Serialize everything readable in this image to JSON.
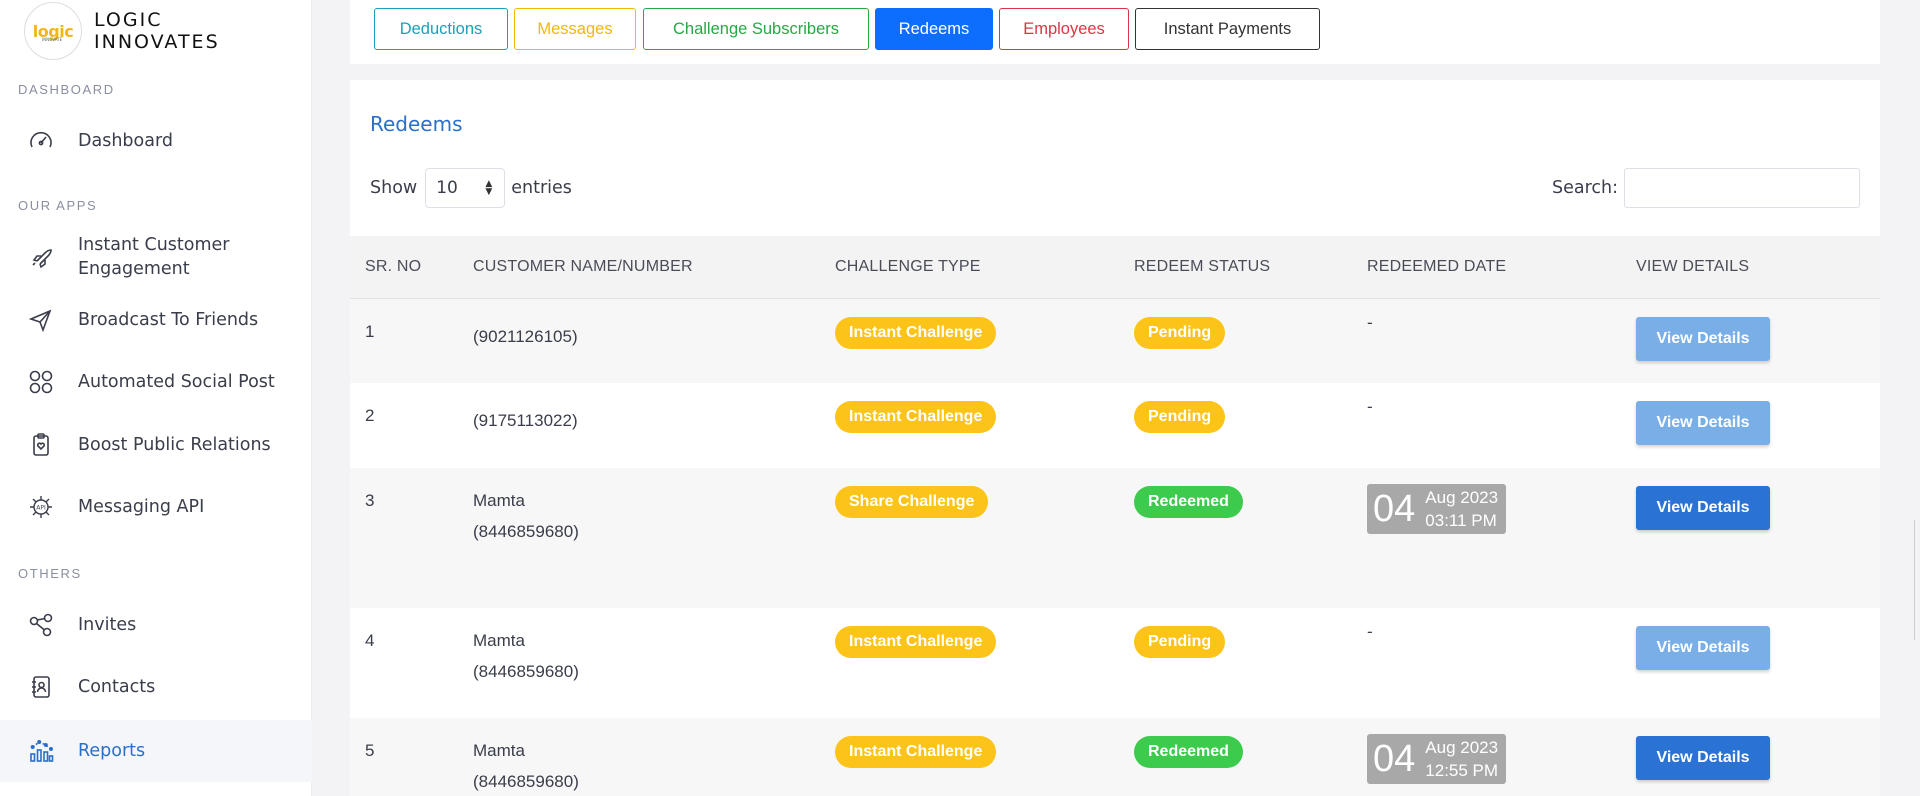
{
  "brand": {
    "logo_text": "logic",
    "logo_small": "INNOVATE",
    "name_line1": "LOGIC",
    "name_line2": "INNOVATES"
  },
  "sidebar": {
    "sections": [
      {
        "heading": "DASHBOARD"
      },
      {
        "heading": "OUR APPS"
      },
      {
        "heading": "OTHERS"
      }
    ],
    "items": [
      {
        "label": "Dashboard",
        "icon": "gauge-icon"
      },
      {
        "label": "Instant Customer Engagement",
        "icon": "rocket-icon"
      },
      {
        "label": "Broadcast To Friends",
        "icon": "send-icon"
      },
      {
        "label": "Automated Social Post",
        "icon": "social-grid-icon"
      },
      {
        "label": "Boost Public Relations",
        "icon": "clipboard-heart-icon"
      },
      {
        "label": "Messaging API",
        "icon": "api-chip-icon"
      },
      {
        "label": "Invites",
        "icon": "share-nodes-icon"
      },
      {
        "label": "Contacts",
        "icon": "contact-book-icon"
      },
      {
        "label": "Reports",
        "icon": "chart-bars-icon",
        "active": true
      }
    ]
  },
  "tabs": [
    {
      "label": "Deductions",
      "color": "#17a2b8"
    },
    {
      "label": "Messages",
      "color": "#f0b90b"
    },
    {
      "label": "Challenge Subscribers",
      "color": "#28a745"
    },
    {
      "label": "Redeems",
      "color": "#0d6efd",
      "active": true
    },
    {
      "label": "Employees",
      "color": "#dc3545"
    },
    {
      "label": "Instant Payments",
      "color": "#333333"
    }
  ],
  "main": {
    "title": "Redeems",
    "show_label": "Show",
    "entries_value": "10",
    "entries_label": "entries",
    "search_label": "Search:",
    "search_value": ""
  },
  "table": {
    "headers": [
      "SR. NO",
      "CUSTOMER NAME/NUMBER",
      "CHALLENGE TYPE",
      "REDEEM STATUS",
      "REDEEMED DATE",
      "VIEW DETAILS"
    ],
    "rows": [
      {
        "sr": "1",
        "name": "",
        "number": "(9021126105)",
        "challenge": "Instant Challenge",
        "status": "Pending",
        "date": "-",
        "day": "",
        "month_year": "",
        "time": "",
        "action": "View Details"
      },
      {
        "sr": "2",
        "name": "",
        "number": "(9175113022)",
        "challenge": "Instant Challenge",
        "status": "Pending",
        "date": "-",
        "day": "",
        "month_year": "",
        "time": "",
        "action": "View Details"
      },
      {
        "sr": "3",
        "name": "Mamta",
        "number": "(8446859680)",
        "challenge": "Share Challenge",
        "status": "Redeemed",
        "date": "",
        "day": "04",
        "month_year": "Aug 2023",
        "time": "03:11 PM",
        "action": "View Details"
      },
      {
        "sr": "4",
        "name": "Mamta",
        "number": "(8446859680)",
        "challenge": "Instant Challenge",
        "status": "Pending",
        "date": "-",
        "day": "",
        "month_year": "",
        "time": "",
        "action": "View Details"
      },
      {
        "sr": "5",
        "name": "Mamta",
        "number": "(8446859680)",
        "challenge": "Instant Challenge",
        "status": "Redeemed",
        "date": "",
        "day": "04",
        "month_year": "Aug 2023",
        "time": "12:55 PM",
        "action": "View Details"
      }
    ]
  },
  "colors": {
    "accent": "#2a6fc9",
    "pending": "#fcc419",
    "redeemed": "#3ccb4d",
    "view_details_active": "#2a72d4",
    "view_details_muted": "#7aaee6"
  }
}
